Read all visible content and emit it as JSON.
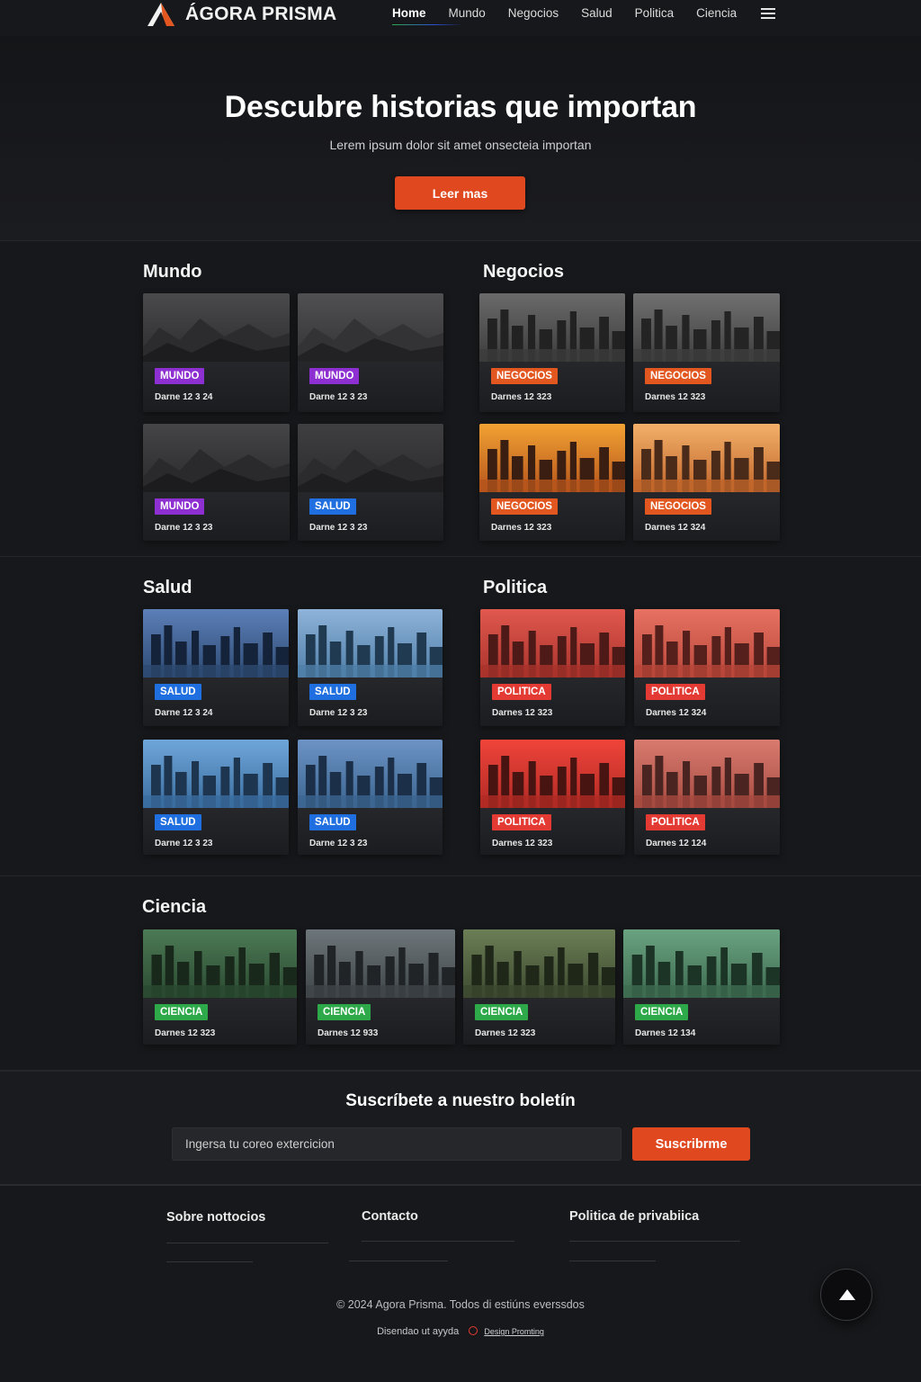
{
  "brand": {
    "name": "ÁGORA PRISMA"
  },
  "nav": {
    "items": [
      "Home",
      "Mundo",
      "Negocios",
      "Salud",
      "Politica",
      "Ciencia"
    ]
  },
  "hero": {
    "title": "Descubre historias que importan",
    "subtitle": "Lerem ipsum dolor sit amet onsecteia importan",
    "button": "Leer mas"
  },
  "sections": {
    "mundo": {
      "title": "Mundo",
      "cards": [
        {
          "tag": "MUNDO",
          "date": "Darne 12 3 24"
        },
        {
          "tag": "MUNDO",
          "date": "Darne 12 3 23"
        },
        {
          "tag": "MUNDO",
          "date": "Darne 12 3 23"
        },
        {
          "tag": "SALUD",
          "date": "Darne 12 3 23"
        }
      ]
    },
    "negocios": {
      "title": "Negocios",
      "cards": [
        {
          "tag": "NEGOCIOS",
          "date": "Darnes 12 323"
        },
        {
          "tag": "NEGOCIOS",
          "date": "Darnes 12 323"
        },
        {
          "tag": "NEGOCIOS",
          "date": "Darnes 12 323"
        },
        {
          "tag": "NEGOCIOS",
          "date": "Darnes 12 324"
        }
      ]
    },
    "salud": {
      "title": "Salud",
      "cards": [
        {
          "tag": "SALUD",
          "date": "Darne 12 3 24"
        },
        {
          "tag": "SALUD",
          "date": "Darne 12 3 23"
        },
        {
          "tag": "SALUD",
          "date": "Darne 12 3 23"
        },
        {
          "tag": "SALUD",
          "date": "Darne 12 3 23"
        }
      ]
    },
    "politica": {
      "title": "Politica",
      "cards": [
        {
          "tag": "POLITICA",
          "date": "Darnes 12 323"
        },
        {
          "tag": "POLITICA",
          "date": "Darnes 12 324"
        },
        {
          "tag": "POLITICA",
          "date": "Darnes 12 323"
        },
        {
          "tag": "POLITICA",
          "date": "Darnes 12 124"
        }
      ]
    },
    "ciencia": {
      "title": "Ciencia",
      "cards": [
        {
          "tag": "CIENCIA",
          "date": "Darnes 12 323"
        },
        {
          "tag": "CIENCIA",
          "date": "Darnes 12 933"
        },
        {
          "tag": "CIENCIA",
          "date": "Darnes 12 323"
        },
        {
          "tag": "CIENCIA",
          "date": "Darnes 12 134"
        }
      ]
    }
  },
  "newsletter": {
    "title": "Suscríbete a nuestro boletín",
    "placeholder": "Ingersa tu coreo extercicion",
    "button": "Suscribrme"
  },
  "footer": {
    "columns": [
      "Sobre nottocios",
      "Contacto",
      "Politica de privabiica"
    ],
    "copyright": "© 2024 Agora Prisma. Todos di estiúns everssdos",
    "credit_text": "Disendao ut ayyda",
    "credit_link": "Design Promting"
  },
  "colors": {
    "accent": "#e0491f",
    "mundo": "#8e2fd1",
    "salud": "#1f6fe0",
    "negocios": "#e2571f",
    "politica": "#e33a33",
    "ciencia": "#2da94a"
  }
}
